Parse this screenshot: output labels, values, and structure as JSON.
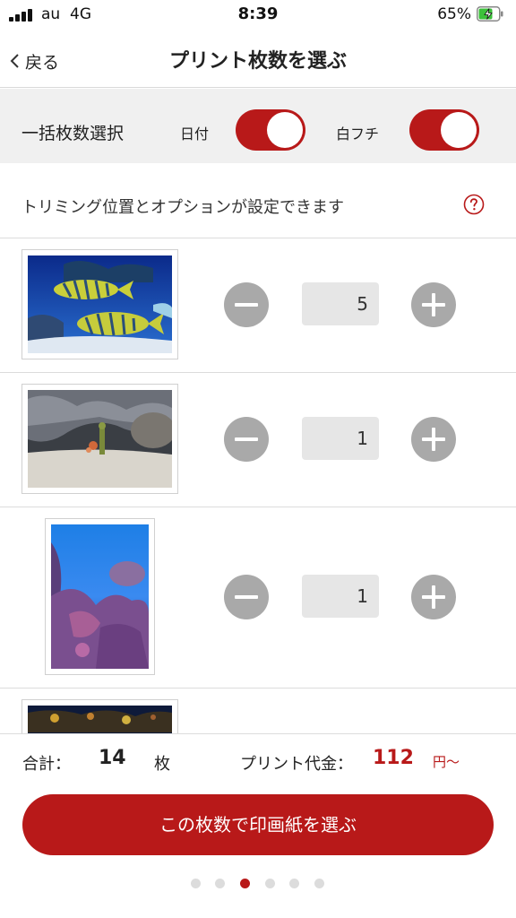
{
  "status_bar": {
    "carrier": "au",
    "network": "4G",
    "time": "8:39",
    "battery_percent": "65%",
    "battery_level": 0.65
  },
  "nav": {
    "back_label": "戻る",
    "title": "プリント枚数を選ぶ"
  },
  "bulk": {
    "label": "一括枚数選択",
    "date_label": "日付",
    "date_on": true,
    "border_label": "白フチ",
    "border_on": true
  },
  "info": {
    "text": "トリミング位置とオプションが設定できます",
    "help_icon": "question-circle-icon"
  },
  "photos": [
    {
      "quantity": "5",
      "orientation": "landscape",
      "subject": "striped-fish"
    },
    {
      "quantity": "1",
      "orientation": "landscape",
      "subject": "rock-sand"
    },
    {
      "quantity": "1",
      "orientation": "portrait",
      "subject": "purple-coral"
    },
    {
      "quantity": "",
      "orientation": "landscape",
      "subject": "dark-reef"
    }
  ],
  "summary": {
    "total_label": "合計：",
    "total_count": "14",
    "count_unit": "枚",
    "price_label": "プリント代金：",
    "price": "112",
    "price_unit": "円〜"
  },
  "cta_label": "この枚数で印画紙を選ぶ",
  "pager": {
    "total": 6,
    "active_index": 2
  },
  "colors": {
    "accent": "#b81919",
    "bulk_bg": "#f0f0f0",
    "stepper": "#a9a9a9"
  }
}
